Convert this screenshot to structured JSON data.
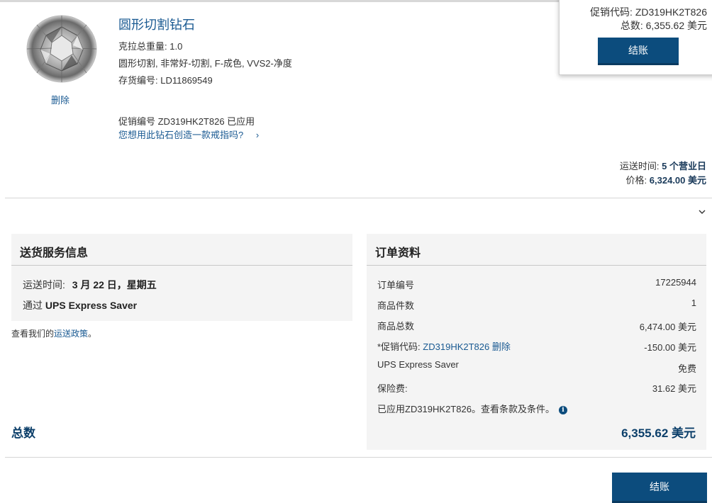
{
  "float_summary": {
    "promo_label": "促销代码:",
    "promo_code": "ZD319HK2T826",
    "total_label": "总数:",
    "total_value": "6,355.62 美元",
    "checkout_label": "结账"
  },
  "product": {
    "title": "圆形切割钻石",
    "carat": "克拉总重量:  1.0",
    "specs": "圆形切割, 非常好-切割, F-成色, VVS2-净度",
    "stock": "存货编号:  LD11869549",
    "delete_label": "删除",
    "promo_applied": "促销编号 ZD319HK2T826 已应用",
    "ring_link": "您想用此钻石创造一款戒指吗?",
    "ship_time_label": "运送时间:",
    "ship_time_value": "5 个营业日",
    "price_label": "价格:",
    "price_value": "6,324.00 美元"
  },
  "shipping": {
    "title": "送货服务信息",
    "time_label": "运送时间:",
    "time_value": "3 月 22 日，星期五",
    "via_label": "通过",
    "via_value": "UPS Express Saver",
    "policy_prefix": "查看我们的",
    "policy_link": "运送政策",
    "policy_suffix": "。"
  },
  "order": {
    "title": "订单资料",
    "rows": [
      {
        "label": "订单编号",
        "value": "17225944"
      },
      {
        "label": "商品件数",
        "value": "1"
      },
      {
        "label": "商品总数",
        "value": "6,474.00 美元"
      },
      {
        "label": "UPS Express Saver",
        "value": "免费"
      },
      {
        "label": "保险费:",
        "value": "31.62 美元"
      }
    ],
    "promo_label": "*促销代码:",
    "promo_code": "ZD319HK2T826",
    "promo_remove": "删除",
    "promo_value": "-150.00 美元",
    "terms_text": "已应用ZD319HK2T826。查看条款及条件。",
    "total_label": "总数",
    "total_value": "6,355.62 美元"
  },
  "bottom_checkout_label": "结账",
  "colors": {
    "accent": "#0c4c7d",
    "link": "#1a5a92",
    "panel": "#f4f4f4"
  }
}
